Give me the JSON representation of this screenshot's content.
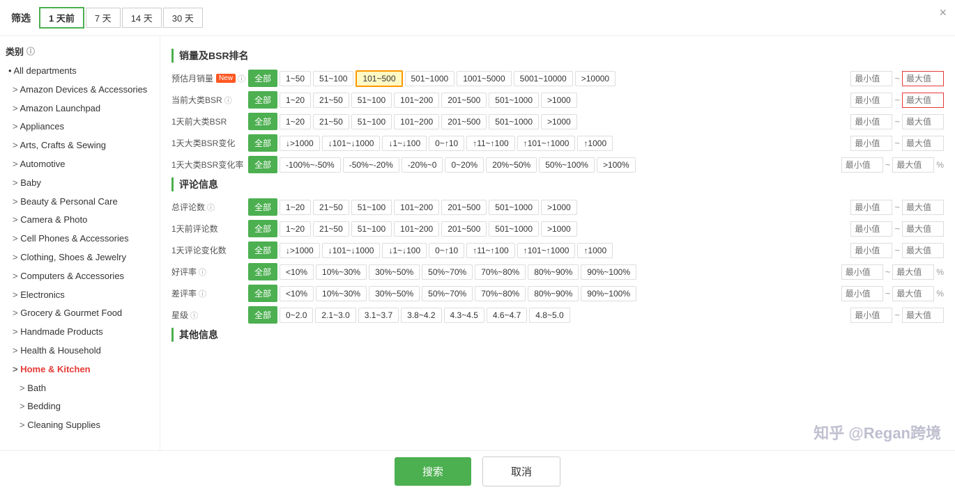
{
  "header": {
    "filter_label": "筛选",
    "close_label": "×",
    "time_buttons": [
      "1 天前",
      "7 天",
      "14 天",
      "30 天"
    ],
    "active_time": "1 天前"
  },
  "sidebar": {
    "section_title": "类别",
    "items": [
      {
        "label": "• All departments",
        "type": "all"
      },
      {
        "label": "Amazon Devices & Accessories",
        "type": "child"
      },
      {
        "label": "Amazon Launchpad",
        "type": "child"
      },
      {
        "label": "Appliances",
        "type": "child"
      },
      {
        "label": "Arts, Crafts & Sewing",
        "type": "child"
      },
      {
        "label": "Automotive",
        "type": "child"
      },
      {
        "label": "Baby",
        "type": "child"
      },
      {
        "label": "Beauty & Personal Care",
        "type": "child"
      },
      {
        "label": "Camera & Photo",
        "type": "child"
      },
      {
        "label": "Cell Phones & Accessories",
        "type": "child"
      },
      {
        "label": "Clothing, Shoes & Jewelry",
        "type": "child"
      },
      {
        "label": "Computers & Accessories",
        "type": "child"
      },
      {
        "label": "Electronics",
        "type": "child"
      },
      {
        "label": "Grocery & Gourmet Food",
        "type": "child"
      },
      {
        "label": "Handmade Products",
        "type": "child"
      },
      {
        "label": "Health & Household",
        "type": "child"
      },
      {
        "label": "Home & Kitchen",
        "type": "active-parent"
      },
      {
        "label": "Bath",
        "type": "sub-child"
      },
      {
        "label": "Bedding",
        "type": "sub-child"
      },
      {
        "label": "Cleaning Supplies",
        "type": "sub-child"
      }
    ]
  },
  "content": {
    "sales_bsr_section": "销量及BSR排名",
    "monthly_sales_label": "预估月销量",
    "monthly_sales_new": "New",
    "monthly_sales_options": [
      "全部",
      "1~50",
      "51~100",
      "101~500",
      "501~1000",
      "1001~5000",
      "5001~10000",
      ">10000"
    ],
    "monthly_sales_selected": "101~500",
    "current_bsr_label": "当前大类BSR",
    "current_bsr_options": [
      "全部",
      "1~20",
      "21~50",
      "51~100",
      "101~200",
      "201~500",
      "501~1000",
      ">1000"
    ],
    "current_bsr_selected": "全部",
    "bsr_1day_label": "1天前大类BSR",
    "bsr_1day_options": [
      "全部",
      "1~20",
      "21~50",
      "51~100",
      "101~200",
      "201~500",
      "501~1000",
      ">1000"
    ],
    "bsr_1day_selected": "全部",
    "bsr_change_label": "1天大类BSR变化",
    "bsr_change_options": [
      "全部",
      "↓>1000",
      "↓101~↓1000",
      "↓1~↓100",
      "0~↑10",
      "↑11~↑100",
      "↑101~↑1000",
      "↑1000"
    ],
    "bsr_change_selected": "全部",
    "bsr_change_rate_label": "1天大类BSR变化率",
    "bsr_change_rate_options": [
      "全部",
      "-100%~-50%",
      "-50%~-20%",
      "-20%~0",
      "0~20%",
      "20%~50%",
      "50%~100%",
      ">100%"
    ],
    "bsr_change_rate_selected": "全部",
    "review_section": "评论信息",
    "total_reviews_label": "总评论数",
    "total_reviews_options": [
      "全部",
      "1~20",
      "21~50",
      "51~100",
      "101~200",
      "201~500",
      "501~1000",
      ">1000"
    ],
    "total_reviews_selected": "全部",
    "reviews_1day_label": "1天前评论数",
    "reviews_1day_options": [
      "全部",
      "1~20",
      "21~50",
      "51~100",
      "101~200",
      "201~500",
      "501~1000",
      ">1000"
    ],
    "reviews_1day_selected": "全部",
    "review_change_label": "1天评论变化数",
    "review_change_options": [
      "全部",
      "↓>1000",
      "↓101~↓1000",
      "↓1~↓100",
      "0~↑10",
      "↑11~↑100",
      "↑101~↑1000",
      "↑1000"
    ],
    "review_change_selected": "全部",
    "positive_rate_label": "好评率",
    "positive_rate_options": [
      "全部",
      "<10%",
      "10%~30%",
      "30%~50%",
      "50%~70%",
      "70%~80%",
      "80%~90%",
      "90%~100%"
    ],
    "positive_rate_selected": "全部",
    "negative_rate_label": "差评率",
    "negative_rate_options": [
      "全部",
      "<10%",
      "10%~30%",
      "30%~50%",
      "50%~70%",
      "70%~80%",
      "80%~90%",
      "90%~100%"
    ],
    "negative_rate_selected": "全部",
    "rating_label": "星级",
    "rating_options": [
      "全部",
      "0~2.0",
      "2.1~3.0",
      "3.1~3.7",
      "3.8~4.2",
      "4.3~4.5",
      "4.6~4.7",
      "4.8~5.0"
    ],
    "rating_selected": "全部",
    "other_section": "其他信息",
    "min_placeholder": "最小值",
    "max_placeholder": "最大值",
    "tilde": "~"
  },
  "actions": {
    "search_label": "搜索",
    "cancel_label": "取消"
  },
  "watermark": "知乎 @Regan跨境"
}
